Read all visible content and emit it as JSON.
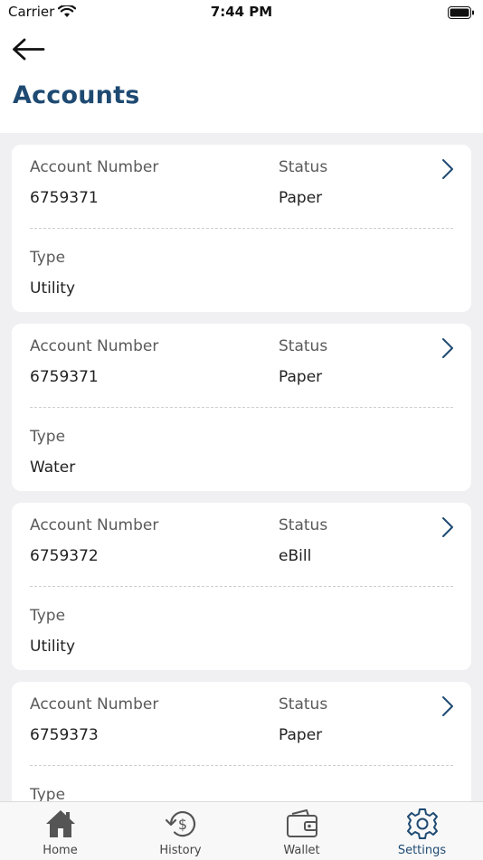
{
  "status_bar": {
    "carrier": "Carrier",
    "time": "7:44 PM"
  },
  "header": {
    "title": "Accounts"
  },
  "labels": {
    "account_number": "Account Number",
    "status": "Status",
    "type": "Type"
  },
  "accounts": [
    {
      "account_number": "6759371",
      "status": "Paper",
      "type": "Utility"
    },
    {
      "account_number": "6759371",
      "status": "Paper",
      "type": "Water"
    },
    {
      "account_number": "6759372",
      "status": "eBill",
      "type": "Utility"
    },
    {
      "account_number": "6759373",
      "status": "Paper",
      "type": ""
    }
  ],
  "tabbar": {
    "home": "Home",
    "history": "History",
    "wallet": "Wallet",
    "settings": "Settings",
    "active": "settings"
  },
  "colors": {
    "accent": "#1e4a72",
    "background": "#f0f0f2"
  }
}
